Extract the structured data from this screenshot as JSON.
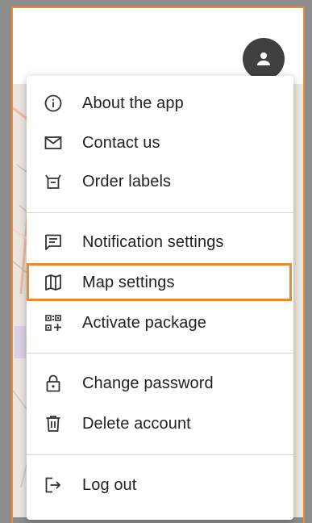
{
  "header": {
    "avatar_icon": "account-icon"
  },
  "menu": {
    "about": {
      "label": "About the app",
      "icon": "info-circle-icon"
    },
    "contact": {
      "label": "Contact us",
      "icon": "mail-icon"
    },
    "order_labels": {
      "label": "Order labels",
      "icon": "tray-icon"
    },
    "notification_settings": {
      "label": "Notification settings",
      "icon": "message-icon"
    },
    "map_settings": {
      "label": "Map settings",
      "icon": "map-icon",
      "highlighted": true
    },
    "activate_package": {
      "label": "Activate package",
      "icon": "qr-add-icon"
    },
    "change_password": {
      "label": "Change password",
      "icon": "lock-icon"
    },
    "delete_account": {
      "label": "Delete account",
      "icon": "trash-icon"
    },
    "log_out": {
      "label": "Log out",
      "icon": "logout-icon"
    }
  },
  "colors": {
    "highlight": "#ef8a2c",
    "avatar_bg": "#404040",
    "text": "#222222",
    "icon": "#333333"
  }
}
